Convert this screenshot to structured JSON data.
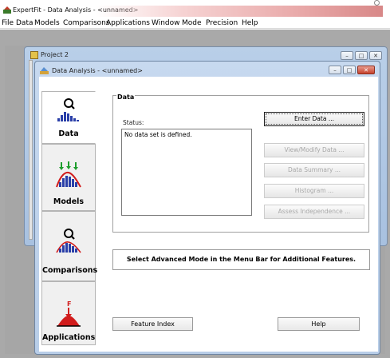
{
  "app": {
    "title": "ExpertFit - Data Analysis - <unnamed>"
  },
  "menu": [
    "File",
    "Data",
    "Models",
    "Comparisons",
    "Applications",
    "Window",
    "Mode",
    "Precision",
    "Help"
  ],
  "project_window": {
    "title": "Project 2"
  },
  "analysis_window": {
    "title": "Data Analysis - <unnamed>"
  },
  "nav_tabs": [
    {
      "label": "Data",
      "icon": "magnifier-histogram-icon"
    },
    {
      "label": "Models",
      "icon": "distribution-fit-icon"
    },
    {
      "label": "Comparisons",
      "icon": "magnifier-histogram-icon"
    },
    {
      "label": "Applications",
      "icon": "application-arrow-icon"
    }
  ],
  "data_panel": {
    "group_title": "Data",
    "status_label": "Status:",
    "status_text": "No data set is defined.",
    "buttons": [
      {
        "label": "Enter Data ...",
        "enabled": true
      },
      {
        "label": "View/Modify Data ...",
        "enabled": false
      },
      {
        "label": "Data Summary ...",
        "enabled": false
      },
      {
        "label": "Histogram ...",
        "enabled": false
      },
      {
        "label": "Assess Independence ...",
        "enabled": false
      }
    ]
  },
  "advanced_message": "Select Advanced Mode in the Menu Bar for Additional Features.",
  "bottom_buttons": {
    "feature_index": "Feature Index",
    "help": "Help"
  },
  "colors": {
    "title_gradient_red": "#d88888",
    "window_frame": "#b8cde8",
    "workspace": "#a9a9a9"
  }
}
